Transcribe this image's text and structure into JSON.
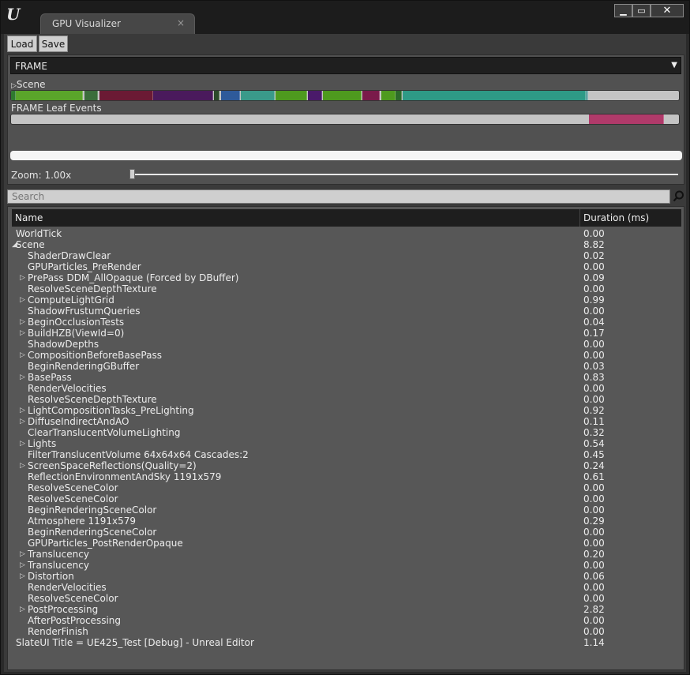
{
  "window": {
    "tab_title": "GPU Visualizer",
    "tab_close": "×",
    "minimize": "▁",
    "maximize": "▭",
    "close": "✕",
    "logo": "U"
  },
  "toolbar": {
    "load_label": "Load",
    "save_label": "Save"
  },
  "frame_select": {
    "value": "FRAME",
    "arrow": "▼"
  },
  "scene": {
    "label": "Scene",
    "expander": "▷"
  },
  "leaf": {
    "label": "FRAME Leaf Events"
  },
  "zoom": {
    "label": "Zoom: 1.00x",
    "level": 0.0
  },
  "search": {
    "placeholder": "Search"
  },
  "table": {
    "columns": {
      "name": "Name",
      "duration": "Duration (ms)"
    },
    "rows": [
      {
        "name": "WorldTick",
        "duration": "0.00",
        "depth": 0,
        "expander": ""
      },
      {
        "name": "Scene",
        "duration": "8.82",
        "depth": 0,
        "expander": "◢"
      },
      {
        "name": "ShaderDrawClear",
        "duration": "0.02",
        "depth": 1,
        "expander": ""
      },
      {
        "name": "GPUParticles_PreRender",
        "duration": "0.00",
        "depth": 1,
        "expander": ""
      },
      {
        "name": "PrePass DDM_AllOpaque (Forced by DBuffer)",
        "duration": "0.09",
        "depth": 1,
        "expander": "▷"
      },
      {
        "name": "ResolveSceneDepthTexture",
        "duration": "0.00",
        "depth": 1,
        "expander": ""
      },
      {
        "name": "ComputeLightGrid",
        "duration": "0.99",
        "depth": 1,
        "expander": "▷"
      },
      {
        "name": "ShadowFrustumQueries",
        "duration": "0.00",
        "depth": 1,
        "expander": ""
      },
      {
        "name": "BeginOcclusionTests",
        "duration": "0.04",
        "depth": 1,
        "expander": "▷"
      },
      {
        "name": "BuildHZB(ViewId=0)",
        "duration": "0.17",
        "depth": 1,
        "expander": "▷"
      },
      {
        "name": "ShadowDepths",
        "duration": "0.00",
        "depth": 1,
        "expander": ""
      },
      {
        "name": "CompositionBeforeBasePass",
        "duration": "0.00",
        "depth": 1,
        "expander": "▷"
      },
      {
        "name": "BeginRenderingGBuffer",
        "duration": "0.03",
        "depth": 1,
        "expander": ""
      },
      {
        "name": "BasePass",
        "duration": "0.83",
        "depth": 1,
        "expander": "▷"
      },
      {
        "name": "RenderVelocities",
        "duration": "0.00",
        "depth": 1,
        "expander": ""
      },
      {
        "name": "ResolveSceneDepthTexture",
        "duration": "0.00",
        "depth": 1,
        "expander": ""
      },
      {
        "name": "LightCompositionTasks_PreLighting",
        "duration": "0.92",
        "depth": 1,
        "expander": "▷"
      },
      {
        "name": "DiffuseIndirectAndAO",
        "duration": "0.11",
        "depth": 1,
        "expander": "▷"
      },
      {
        "name": "ClearTranslucentVolumeLighting",
        "duration": "0.32",
        "depth": 1,
        "expander": ""
      },
      {
        "name": "Lights",
        "duration": "0.54",
        "depth": 1,
        "expander": "▷"
      },
      {
        "name": "FilterTranslucentVolume 64x64x64 Cascades:2",
        "duration": "0.45",
        "depth": 1,
        "expander": ""
      },
      {
        "name": "ScreenSpaceReflections(Quality=2)",
        "duration": "0.24",
        "depth": 1,
        "expander": "▷"
      },
      {
        "name": "ReflectionEnvironmentAndSky 1191x579",
        "duration": "0.61",
        "depth": 1,
        "expander": ""
      },
      {
        "name": "ResolveSceneColor",
        "duration": "0.00",
        "depth": 1,
        "expander": ""
      },
      {
        "name": "ResolveSceneColor",
        "duration": "0.00",
        "depth": 1,
        "expander": ""
      },
      {
        "name": "BeginRenderingSceneColor",
        "duration": "0.00",
        "depth": 1,
        "expander": ""
      },
      {
        "name": "Atmosphere 1191x579",
        "duration": "0.29",
        "depth": 1,
        "expander": ""
      },
      {
        "name": "BeginRenderingSceneColor",
        "duration": "0.00",
        "depth": 1,
        "expander": ""
      },
      {
        "name": "GPUParticles_PostRenderOpaque",
        "duration": "0.00",
        "depth": 1,
        "expander": ""
      },
      {
        "name": "Translucency",
        "duration": "0.20",
        "depth": 1,
        "expander": "▷"
      },
      {
        "name": "Translucency",
        "duration": "0.00",
        "depth": 1,
        "expander": "▷"
      },
      {
        "name": "Distortion",
        "duration": "0.06",
        "depth": 1,
        "expander": "▷"
      },
      {
        "name": "RenderVelocities",
        "duration": "0.00",
        "depth": 1,
        "expander": ""
      },
      {
        "name": "ResolveSceneColor",
        "duration": "0.00",
        "depth": 1,
        "expander": ""
      },
      {
        "name": "PostProcessing",
        "duration": "2.82",
        "depth": 1,
        "expander": "▷"
      },
      {
        "name": "AfterPostProcessing",
        "duration": "0.00",
        "depth": 1,
        "expander": ""
      },
      {
        "name": "RenderFinish",
        "duration": "0.00",
        "depth": 1,
        "expander": ""
      },
      {
        "name": "SlateUI Title = UE425_Test [Debug] - Unreal Editor",
        "duration": "1.14",
        "depth": 0,
        "expander": ""
      }
    ]
  },
  "scene_bar_segments": [
    {
      "color": "#2f7a2f",
      "start": 0.0,
      "end": 0.007
    },
    {
      "color": "#5aa52a",
      "start": 0.007,
      "end": 0.108
    },
    {
      "color": "#3b6d3b",
      "start": 0.11,
      "end": 0.13
    },
    {
      "color": "#6b1a34",
      "start": 0.132,
      "end": 0.212
    },
    {
      "color": "#4a1a5c",
      "start": 0.213,
      "end": 0.303
    },
    {
      "color": "#2c4a2a",
      "start": 0.304,
      "end": 0.312
    },
    {
      "color": "#2e5a9a",
      "start": 0.314,
      "end": 0.342
    },
    {
      "color": "#3a9a8a",
      "start": 0.344,
      "end": 0.395
    },
    {
      "color": "#4e9a1e",
      "start": 0.396,
      "end": 0.443
    },
    {
      "color": "#4a1a6a",
      "start": 0.444,
      "end": 0.465
    },
    {
      "color": "#4e9a1e",
      "start": 0.467,
      "end": 0.525
    },
    {
      "color": "#7a1a4a",
      "start": 0.526,
      "end": 0.552
    },
    {
      "color": "#4e9a1e",
      "start": 0.554,
      "end": 0.575
    },
    {
      "color": "#2c6a2a",
      "start": 0.576,
      "end": 0.585
    },
    {
      "color": "#2e9a86",
      "start": 0.586,
      "end": 0.86
    },
    {
      "color": "#5fa0a0",
      "start": 0.861,
      "end": 0.864
    }
  ],
  "leaf_bar_segments": [
    {
      "color": "#b03a6a",
      "start": 0.865,
      "end": 0.977
    }
  ]
}
